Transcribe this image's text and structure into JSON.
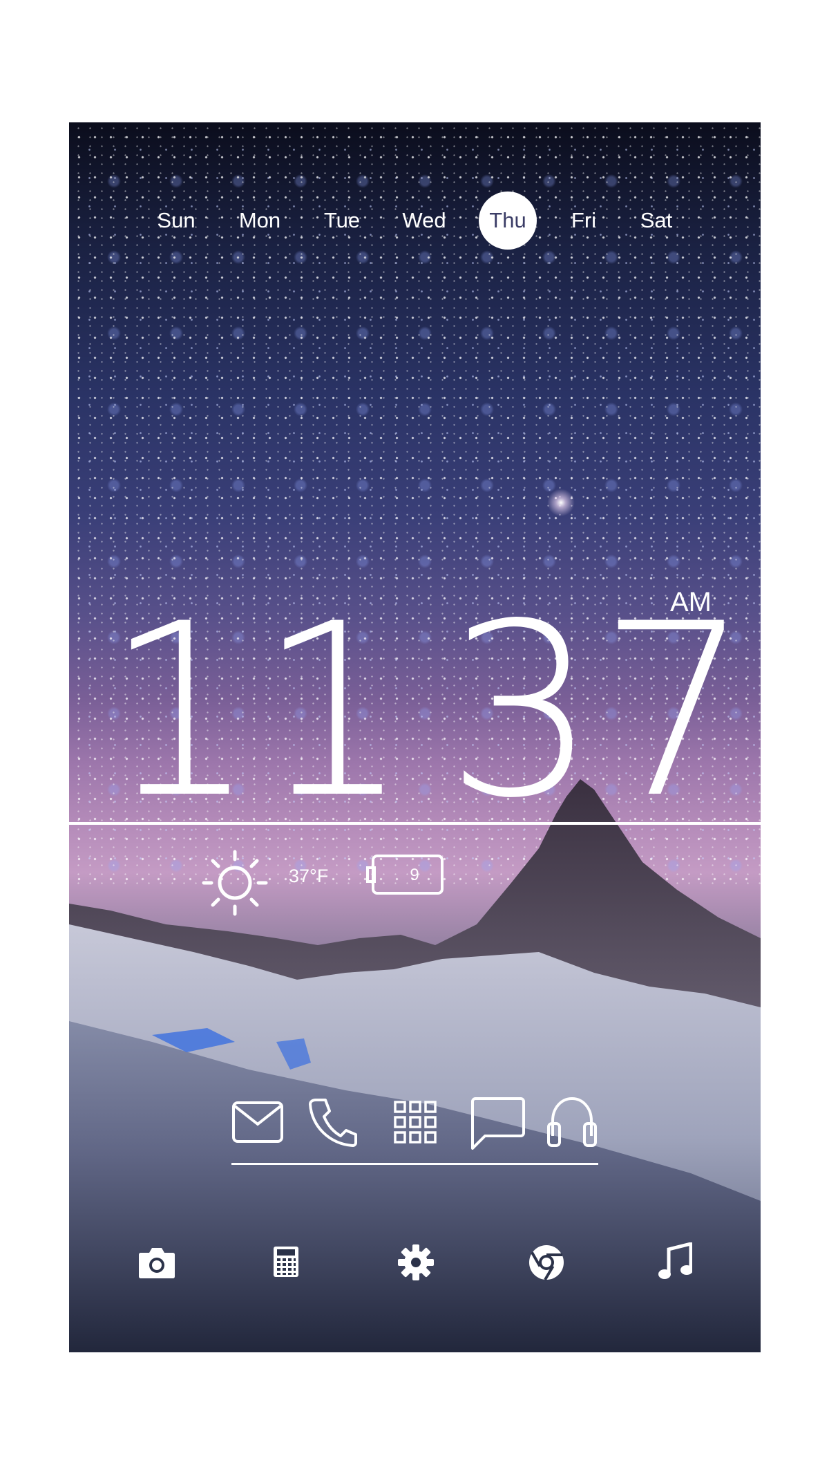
{
  "week": {
    "days": [
      "Sun",
      "Mon",
      "Tue",
      "Wed",
      "Thu",
      "Fri",
      "Sat"
    ],
    "selected": "Thu"
  },
  "clock": {
    "hours": "11",
    "minutes": "37",
    "period": "AM"
  },
  "status": {
    "weather_icon": "sun-icon",
    "temperature": "37°F",
    "battery_icon": "battery-icon",
    "battery_level": "9"
  },
  "favorites_dock": {
    "icons": [
      "mail-icon",
      "phone-icon",
      "app-drawer-icon",
      "messages-icon",
      "headphones-icon"
    ]
  },
  "bottom_dock": {
    "icons": [
      "camera-icon",
      "calculator-icon",
      "settings-icon",
      "chrome-icon",
      "music-icon"
    ]
  },
  "colors": {
    "foreground": "#ffffff",
    "selected_day_text": "#3b3d66"
  }
}
